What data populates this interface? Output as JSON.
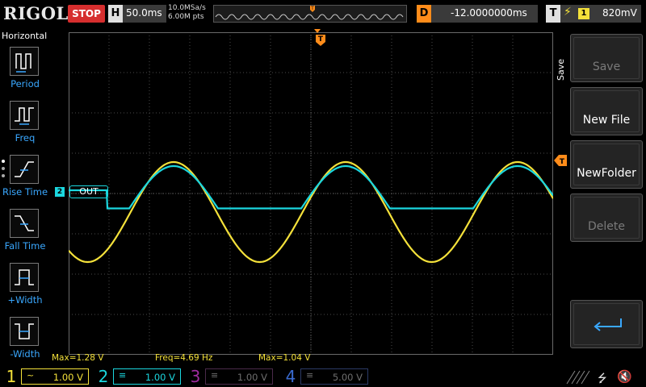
{
  "brand": "RIGOL",
  "run_state": "STOP",
  "timebase": {
    "key": "H",
    "value": "50.0ms"
  },
  "acquisition": {
    "sample_rate": "10.0MSa/s",
    "memory_depth": "6.00M pts"
  },
  "trigger_position": {
    "key": "D",
    "value": "-12.0000000ms"
  },
  "trigger": {
    "key": "T",
    "slope_icon": "rising-edge-icon",
    "source": "1",
    "level": "820mV"
  },
  "left_panel": {
    "title": "Horizontal",
    "items": [
      {
        "label": "Period",
        "icon": "period-icon"
      },
      {
        "label": "Freq",
        "icon": "frequency-icon"
      },
      {
        "label": "Rise Time",
        "icon": "rise-time-icon"
      },
      {
        "label": "Fall Time",
        "icon": "fall-time-icon"
      },
      {
        "label": "+Width",
        "icon": "positive-width-icon"
      },
      {
        "label": "-Width",
        "icon": "negative-width-icon"
      }
    ]
  },
  "channel2_label": "OUT",
  "measurements": {
    "max_ch1": "Max=1.28 V",
    "freq": "Freq=4.69 Hz",
    "max_ch2": "Max=1.04 V"
  },
  "right_menu": {
    "title": "Save",
    "buttons": [
      {
        "label": "Save",
        "enabled": false
      },
      {
        "label": "New File",
        "enabled": true
      },
      {
        "label": "NewFolder",
        "enabled": true
      },
      {
        "label": "Delete",
        "enabled": false
      }
    ],
    "return_icon": "return-arrow-icon"
  },
  "channels": [
    {
      "num": "1",
      "coupling": "~",
      "scale": "1.00 V",
      "color": "#f4e13a"
    },
    {
      "num": "2",
      "coupling": "≡",
      "scale": "1.00 V",
      "color": "#1bd7df"
    },
    {
      "num": "3",
      "coupling": "≡",
      "scale": "1.00 V",
      "color": "#a02ca0"
    },
    {
      "num": "4",
      "coupling": "≡",
      "scale": "5.00 V",
      "color": "#3a6bd0"
    }
  ],
  "colors": {
    "ch1": "#f4e13a",
    "ch2": "#1bd7df",
    "trigger": "#ff8c1a",
    "stop": "#d62e2e",
    "menu_text": "#3aa8ff"
  }
}
